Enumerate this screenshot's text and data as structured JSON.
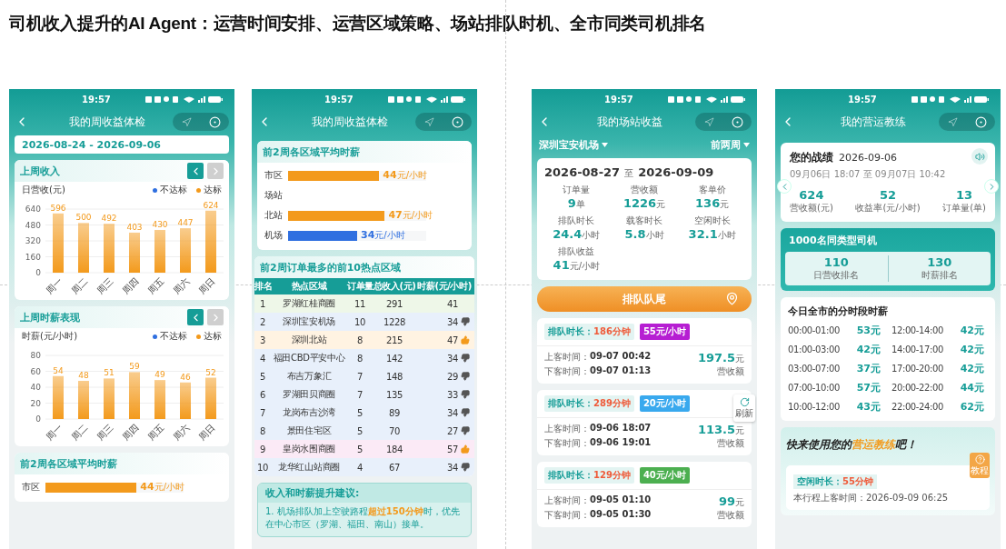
{
  "slide_title": "司机收入提升的AI Agent：运营时间安排、运营区域策略、场站排队时机、全市同类司机排名",
  "weekly_report": {
    "time": "19:57",
    "title": "我的周收益体检",
    "date_range": "2026-08-24 - 2026-09-06",
    "charts": [
      {
        "title": "上周收入",
        "prev_disabled": false,
        "next_disabled": true,
        "legend": [
          {
            "label": "不达标",
            "color": "#2f6fe0"
          }
        ],
        "chart_data": {
          "type": "bar",
          "grid": true,
          "ylabel": "日营收(元)",
          "categories": [
            "周一",
            "周二",
            "周三",
            "周四",
            "周五",
            "周六",
            "周日"
          ],
          "series": [
            {
              "name": "达标",
              "color": "#f39a1c",
              "values": [
                596,
                500,
                492,
                403,
                430,
                447,
                624
              ]
            }
          ],
          "ylim": [
            0,
            640
          ],
          "yticks": [
            0,
            160,
            320,
            480,
            640
          ],
          "data_labels": true
        }
      },
      {
        "title": "上周时薪表现",
        "prev_disabled": false,
        "next_disabled": true,
        "legend": [
          {
            "label": "不达标",
            "color": "#2f6fe0"
          }
        ],
        "chart_data": {
          "type": "bar",
          "grid": true,
          "ylabel": "时薪(元/小时)",
          "categories": [
            "周一",
            "周二",
            "周三",
            "周四",
            "周五",
            "周六",
            "周日"
          ],
          "series": [
            {
              "name": "达标",
              "color": "#f39a1c",
              "values": [
                54,
                48,
                51,
                59,
                49,
                46,
                52
              ]
            }
          ],
          "ylim": [
            0,
            80
          ],
          "yticks": [
            0,
            20,
            40,
            60,
            80
          ],
          "data_labels": true
        }
      }
    ],
    "region_card": {
      "title": "前2周各区域平均时薪",
      "rows": [
        {
          "label": "市区",
          "level": 0.66,
          "value": "**44**元/小时",
          "color": "#f39a1c"
        }
      ]
    }
  },
  "weekly_report_scrolled": {
    "time": "19:57",
    "title": "我的周收益体检",
    "region_card": {
      "title": "前2周各区域平均时薪",
      "rows": [
        {
          "label": "市区",
          "level": 0.66,
          "value": "**44**元/小时",
          "color": "#f39a1c"
        },
        {
          "label": "场站"
        },
        {
          "label": "北站",
          "level": 0.7,
          "value": "**47**元/小时",
          "color": "#f39a1c"
        },
        {
          "label": "机场",
          "level": 0.5,
          "value": "**34**元/小时",
          "color": "#2f6fe0"
        }
      ]
    },
    "hotspots": {
      "title": "前2周订单最多的前10热点区域",
      "columns": [
        "排名",
        "热点区域",
        "订单量",
        "总收入(元)",
        "时薪(元/小时)"
      ],
      "rows": [
        {
          "cells": [
            "1",
            "罗湖红桂商圈",
            "11",
            "291",
            "41"
          ],
          "kind": "plain",
          "color": "#eef7e8"
        },
        {
          "cells": [
            "2",
            "深圳宝安机场",
            "10",
            "1228",
            "34"
          ],
          "kind": "down",
          "color": "#e8f0fb"
        },
        {
          "cells": [
            "3",
            "深圳北站",
            "8",
            "215",
            "47"
          ],
          "kind": "up",
          "color": "#fff3e2"
        },
        {
          "cells": [
            "4",
            "福田CBD平安中心",
            "8",
            "142",
            "34"
          ],
          "kind": "down",
          "color": "#e8f0fb"
        },
        {
          "cells": [
            "5",
            "布吉万象汇",
            "7",
            "148",
            "29"
          ],
          "kind": "down",
          "color": "#e8f0fb"
        },
        {
          "cells": [
            "6",
            "罗湖田贝商圈",
            "7",
            "135",
            "33"
          ],
          "kind": "down",
          "color": "#e8f0fb"
        },
        {
          "cells": [
            "7",
            "龙岗布吉沙湾",
            "5",
            "89",
            "34"
          ],
          "kind": "down",
          "color": "#e8f0fb"
        },
        {
          "cells": [
            "8",
            "景田住宅区",
            "5",
            "70",
            "27"
          ],
          "kind": "down",
          "color": "#e8f0fb"
        },
        {
          "cells": [
            "9",
            "皇岗水围商圈",
            "5",
            "184",
            "57"
          ],
          "kind": "up",
          "color": "#fbeaf6"
        },
        {
          "cells": [
            "10",
            "龙华红山站商圈",
            "4",
            "67",
            "34"
          ],
          "kind": "down",
          "color": "#e8f0fb"
        }
      ]
    },
    "advice": {
      "title": "收入和时薪提升建议:",
      "text": "1. 机场排队加上空驶路程**超过150分钟**时，优先在中心市区（罗湖、福田、南山）接单。"
    }
  },
  "station_income": {
    "time": "19:57",
    "title": "我的场站收益",
    "station": "深圳宝安机场",
    "period": "前两周",
    "date_from": "2026-08-27",
    "date_sep": "至",
    "date_to": "2026-09-09",
    "stats": [
      {
        "label": "订单量",
        "value": "9",
        "unit": "单"
      },
      {
        "label": "营收额",
        "value": "1226",
        "unit": "元"
      },
      {
        "label": "客单价",
        "value": "136",
        "unit": "元"
      },
      {
        "label": "排队时长",
        "value": "24.4",
        "unit": "小时"
      },
      {
        "label": "载客时长",
        "value": "5.8",
        "unit": "小时"
      },
      {
        "label": "空闲时长",
        "value": "32.1",
        "unit": "小时"
      },
      {
        "label": "排队收益",
        "value": "41",
        "unit": "元/小时"
      }
    ],
    "queue_button": "排队队尾",
    "refresh": "刷新",
    "trips": [
      {
        "queue_label": "排队时长：",
        "queue_value": "186分钟",
        "rate": "55元/小时",
        "color": "#b61ed2",
        "pickup_label": "上客时间：",
        "pickup": "09-07 00:42",
        "dropoff_label": "下客时间：",
        "dropoff": "09-07 01:13",
        "amount": "197.5",
        "unit": "元",
        "amount_label": "营收额"
      },
      {
        "queue_label": "排队时长：",
        "queue_value": "289分钟",
        "rate": "20元/小时",
        "color": "#39a9ee",
        "pickup_label": "上客时间：",
        "pickup": "09-06 18:07",
        "dropoff_label": "下客时间：",
        "dropoff": "09-06 19:01",
        "amount": "113.5",
        "unit": "元",
        "amount_label": "营收额"
      },
      {
        "queue_label": "排队时长：",
        "queue_value": "129分钟",
        "rate": "40元/小时",
        "color": "#4caf50",
        "pickup_label": "上客时间：",
        "pickup": "09-05 01:10",
        "dropoff_label": "下客时间：",
        "dropoff": "09-05 01:30",
        "amount": "99",
        "unit": "元",
        "amount_label": "营收额"
      }
    ]
  },
  "coach": {
    "time": "19:57",
    "title": "我的营运教练",
    "record": {
      "title": "您的战绩",
      "date": "2026-09-06",
      "range": "09月06日 18:07 至 09月07日 10:42",
      "stats": [
        {
          "value": "624",
          "label": "营收额(元)"
        },
        {
          "value": "52",
          "label": "收益率(元/小时)"
        },
        {
          "value": "13",
          "label": "订单量(单)"
        }
      ]
    },
    "ranking": {
      "title": "1000名同类型司机",
      "items": [
        {
          "value": "110",
          "label": "日营收排名"
        },
        {
          "value": "130",
          "label": "时薪排名"
        }
      ]
    },
    "hourly": {
      "title": "今日全市的分时段时薪",
      "slots": [
        {
          "time": "00:00-01:00",
          "value": "53元"
        },
        {
          "time": "12:00-14:00",
          "value": "42元"
        },
        {
          "time": "01:00-03:00",
          "value": "42元"
        },
        {
          "time": "14:00-17:00",
          "value": "42元"
        },
        {
          "time": "03:00-07:00",
          "value": "37元"
        },
        {
          "time": "17:00-20:00",
          "value": "42元"
        },
        {
          "time": "07:00-10:00",
          "value": "57元"
        },
        {
          "time": "20:00-22:00",
          "value": "44元"
        },
        {
          "time": "10:00-12:00",
          "value": "43元"
        },
        {
          "time": "22:00-24:00",
          "value": "62元"
        }
      ]
    },
    "promo": "快来使用您的**营运教练**吧！",
    "idle": {
      "label": "空闲时长：",
      "value": "55分钟",
      "pickup": "本行程上客时间：2026-09-09 06:25"
    },
    "tutorial": "教程"
  }
}
